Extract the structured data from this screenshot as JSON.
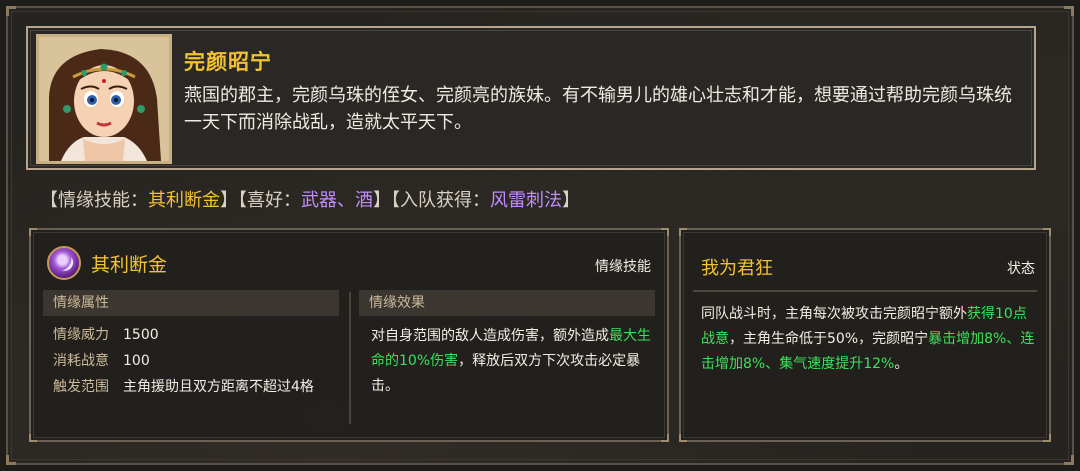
{
  "character": {
    "name": "完颜昭宁",
    "description": "燕国的郡主，完颜乌珠的侄女、完颜亮的族妹。有不输男儿的雄心壮志和才能，想要通过帮助完颜乌珠统一天下而消除战乱，造就太平天下。"
  },
  "tags": {
    "skill_label": "情缘技能：",
    "skill_value": "其利断金",
    "hobby_label": "喜好：",
    "hobby_value": "武器、酒",
    "join_label": "入队获得：",
    "join_value": "风雷刺法"
  },
  "skill_panel": {
    "name": "其利断金",
    "type": "情缘技能",
    "attributes_header": "情缘属性",
    "effect_header": "情缘效果",
    "attributes": [
      {
        "label": "情缘威力",
        "value": "1500"
      },
      {
        "label": "消耗战意",
        "value": "100"
      },
      {
        "label": "触发范围",
        "value": "主角援助且双方距离不超过4格"
      }
    ],
    "effect": {
      "part1": "对自身范围的敌人造成伤害，额外造成",
      "highlight": "最大生命的10%伤害",
      "part2": "，释放后双方下次攻击必定暴击。"
    }
  },
  "status_panel": {
    "title": "我为君狂",
    "type": "状态",
    "text": {
      "part1": "同队战斗时，主角每次被攻击完颜昭宁额外",
      "hl1": "获得10点战意",
      "part2": "，主角生命低于50%，完颜昭宁",
      "hl2": "暴击增加8%、连击增加8%、集气速度提升12%",
      "part3": "。"
    }
  },
  "colors": {
    "gold": "#f1c232",
    "purple": "#c28bff",
    "green": "#3ee05a",
    "border": "#b7a58a"
  }
}
